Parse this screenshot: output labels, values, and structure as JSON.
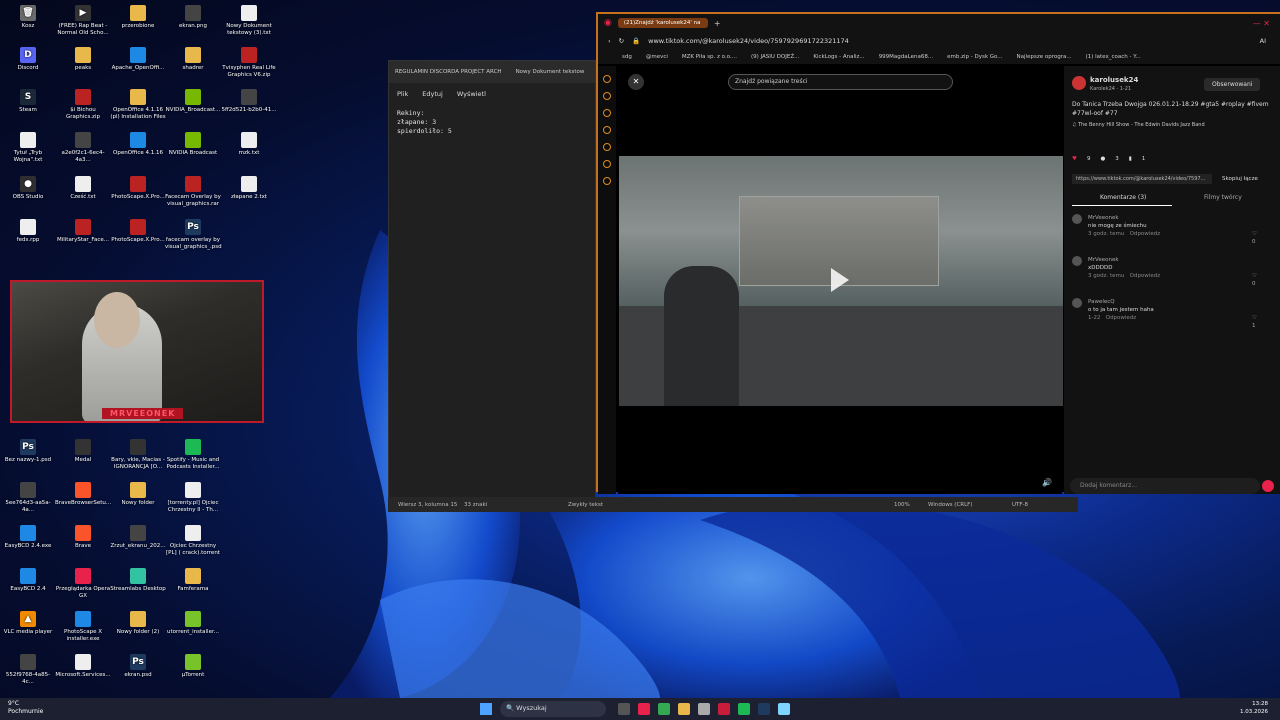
{
  "desktop_icons": [
    {
      "label": "Kosz",
      "color": "#6a6a6a",
      "glyph": "🗑"
    },
    {
      "label": "(FREE) Rap Beat - Normal  Old Scho...",
      "color": "#333",
      "glyph": "▶"
    },
    {
      "label": "przerobione",
      "color": "#e8b94a",
      "glyph": ""
    },
    {
      "label": "ekran.png",
      "color": "#444",
      "glyph": ""
    },
    {
      "label": "Nowy Dokument tekstowy (3).txt",
      "color": "#eee",
      "glyph": ""
    },
    {
      "label": "Discord",
      "color": "#5865f2",
      "glyph": "D"
    },
    {
      "label": "peaks",
      "color": "#e8b94a",
      "glyph": ""
    },
    {
      "label": "Apache_OpenOffi...",
      "color": "#1e88e5",
      "glyph": ""
    },
    {
      "label": "shadrer",
      "color": "#e8b94a",
      "glyph": ""
    },
    {
      "label": "Tvisyphen Real Life Graphics V6.zip",
      "color": "#b22",
      "glyph": ""
    },
    {
      "label": "Steam",
      "color": "#1b2838",
      "glyph": "S"
    },
    {
      "label": "$i Bichou Graphics.zip",
      "color": "#b22",
      "glyph": ""
    },
    {
      "label": "OpenOffice 4.1.16 (pl) Installation Files",
      "color": "#e8b94a",
      "glyph": ""
    },
    {
      "label": "NVIDIA_Broadcast...",
      "color": "#76b900",
      "glyph": ""
    },
    {
      "label": "5ff2d521-b2b0-41...",
      "color": "#444",
      "glyph": ""
    },
    {
      "label": "Tytuł „Tryb Wojna\".txt",
      "color": "#eee",
      "glyph": ""
    },
    {
      "label": "a2e0f2c1-6ec4-4a3...",
      "color": "#444",
      "glyph": ""
    },
    {
      "label": "OpenOffice 4.1.16",
      "color": "#1e88e5",
      "glyph": ""
    },
    {
      "label": "NVIDIA Broadcast",
      "color": "#76b900",
      "glyph": ""
    },
    {
      "label": "mzk.txt",
      "color": "#eee",
      "glyph": ""
    },
    {
      "label": "OBS Studio",
      "color": "#302e31",
      "glyph": "●"
    },
    {
      "label": "Cześć.txt",
      "color": "#eee",
      "glyph": ""
    },
    {
      "label": "PhotoScape.X.Pro...",
      "color": "#b22",
      "glyph": ""
    },
    {
      "label": "Facecam Overlay by visual_graphics.rar",
      "color": "#b22",
      "glyph": ""
    },
    {
      "label": "złapane 2.txt",
      "color": "#eee",
      "glyph": ""
    },
    {
      "label": "feds.rpp",
      "color": "#eee",
      "glyph": ""
    },
    {
      "label": "MilitaryStar_Face...",
      "color": "#b22",
      "glyph": ""
    },
    {
      "label": "PhotoScape.X.Pro...",
      "color": "#b22",
      "glyph": ""
    },
    {
      "label": "facecam overlay by visual_graphics_.psd",
      "color": "#1e3a5f",
      "glyph": "Ps"
    },
    {
      "label": "Bez nazwy-1.psd",
      "color": "#1e3a5f",
      "glyph": "Ps"
    },
    {
      "label": "Medal",
      "color": "#333",
      "glyph": ""
    },
    {
      "label": "Bary, vkie, Macias - IGNORANCJA [O...",
      "color": "#333",
      "glyph": ""
    },
    {
      "label": "Spotify - Music and Podcasts Installer...",
      "color": "#1db954",
      "glyph": ""
    },
    {
      "label": "5ee764d3-aa5a-4a...",
      "color": "#444",
      "glyph": ""
    },
    {
      "label": "BraveBrowserSetu...",
      "color": "#fb542b",
      "glyph": ""
    },
    {
      "label": "Nowy folder",
      "color": "#e8b94a",
      "glyph": ""
    },
    {
      "label": "[torrenty.pl] Ojciec Chrzestny II - Th...",
      "color": "#eee",
      "glyph": ""
    },
    {
      "label": "EasyBCD 2.4.exe",
      "color": "#1e88e5",
      "glyph": ""
    },
    {
      "label": "Brave",
      "color": "#fb542b",
      "glyph": ""
    },
    {
      "label": "Zrzut_ekranu_202...",
      "color": "#444",
      "glyph": ""
    },
    {
      "label": "Ojciec Chrzestny [PL] ( crack).torrent",
      "color": "#eee",
      "glyph": ""
    },
    {
      "label": "EasyBCD 2.4",
      "color": "#1e88e5",
      "glyph": ""
    },
    {
      "label": "Przeglądarka Opera GX",
      "color": "#e8224a",
      "glyph": ""
    },
    {
      "label": "Streamlabs Desktop",
      "color": "#31c3a2",
      "glyph": ""
    },
    {
      "label": "Famferama",
      "color": "#e8b94a",
      "glyph": ""
    },
    {
      "label": "VLC media player",
      "color": "#f18a00",
      "glyph": "▲"
    },
    {
      "label": "PhotoScape X installer.exe",
      "color": "#1e88e5",
      "glyph": ""
    },
    {
      "label": "Nowy folder (2)",
      "color": "#e8b94a",
      "glyph": ""
    },
    {
      "label": "utorrent_installer...",
      "color": "#78c32a",
      "glyph": ""
    },
    {
      "label": "552f9768-4a85-4c...",
      "color": "#444",
      "glyph": ""
    },
    {
      "label": "Microsoft.Services...",
      "color": "#eee",
      "glyph": ""
    },
    {
      "label": "ekran.psd",
      "color": "#1e3a5f",
      "glyph": "Ps"
    },
    {
      "label": "µTorrent",
      "color": "#78c32a",
      "glyph": ""
    }
  ],
  "webcam": {
    "overlay_name": "MRVEEONEK"
  },
  "notepad": {
    "tab1": "REGULAMIN DISCORDA PROJECT ARCH",
    "tab2": "Nowy Dokument tekstow",
    "menu": [
      "Plik",
      "Edytuj",
      "Wyświetl"
    ],
    "content": "Rekiny:\nzłapane: 3\nspierdoliło: 5",
    "status_pos": "Wiersz 3, kolumna 15",
    "status_chars": "33 znaki",
    "status_mode": "Zwykły tekst",
    "status_zoom": "100%",
    "status_eol": "Windows (CRLF)",
    "status_enc": "UTF-8"
  },
  "browser": {
    "tab_title": "(21)Znajdź 'karolusek24' na",
    "url": "www.tiktok.com/@karolusek24/video/7597929691722321174",
    "bookmarks": [
      "sdg",
      "@mevci",
      "MZK Piła sp. z o.o....",
      "(9) JASIU DOJEŻ...",
      "KickLogs - Analiz...",
      "999MagdaLena68...",
      "emb.zip - Dysk Go...",
      "Najlepsze oprogra...",
      "(1) latex_coach - Y..."
    ],
    "ai_label": "AI"
  },
  "tiktok": {
    "search_placeholder": "Znajdź powiązane treści",
    "author": "karolusek24",
    "author_sub": "Karolek24 · 1-21",
    "follow": "Obserwowani",
    "caption": "Do Tanica Trzeba Dwojga 026.01.21-18.29 #gta5 #roplay #fivem #77wl-oof #77",
    "music": "♫ The Benny Hill Show - The Edwin Davids Jazz Band",
    "likes": "9",
    "comments_count": "3",
    "saves": "1",
    "link": "https://www.tiktok.com/@karolusek24/video/7597...",
    "copy": "Skopiuj łącze",
    "tab_comments": "Komentarze (3)",
    "tab_creator": "Filmy twórcy",
    "comments": [
      {
        "user": "MrVeeonek",
        "text": "nie mogę ze śmiechu",
        "meta": "3 godz. temu",
        "reply": "Odpowiedz",
        "likes": "0"
      },
      {
        "user": "MrVeeonek",
        "text": "xDDDDD",
        "meta": "3 godz. temu",
        "reply": "Odpowiedz",
        "likes": "0"
      },
      {
        "user": "PawelecQ",
        "text": "o to ja tam jestem haha",
        "meta": "1-22",
        "reply": "Odpowiedz",
        "likes": "1"
      }
    ],
    "add_comment": "Dodaj komentarz..."
  },
  "taskbar": {
    "weather_temp": "9°C",
    "weather_desc": "Pochmurnie",
    "search": "Wyszukaj",
    "time": "13:28",
    "date": "1.03.2026"
  }
}
